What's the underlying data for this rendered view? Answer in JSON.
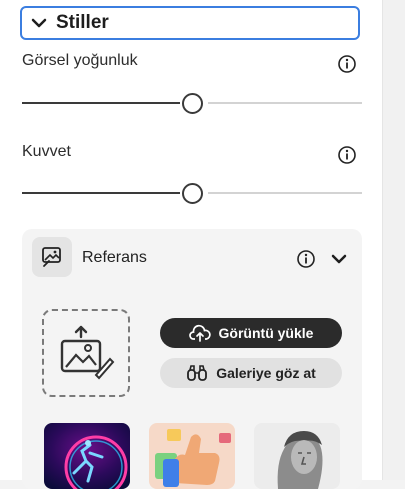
{
  "section": {
    "title": "Stiller"
  },
  "sliders": [
    {
      "label": "Görsel yoğunluk",
      "value": 0.5
    },
    {
      "label": "Kuvvet",
      "value": 0.5
    }
  ],
  "reference": {
    "title": "Referans",
    "upload_button": "Görüntü yükle",
    "gallery_button": "Galeriye göz at",
    "thumbnails": [
      {
        "name": "neon-dancer-thumbnail"
      },
      {
        "name": "thumbs-up-thumbnail"
      },
      {
        "name": "statue-bust-thumbnail"
      }
    ]
  },
  "colors": {
    "focus_border": "#3b7ee0",
    "primary_button": "#2b2b2b",
    "secondary_button": "#e1e1e1"
  },
  "icons": [
    "chevron-down-icon",
    "info-icon",
    "image-reference-icon",
    "image-upload-icon",
    "cloud-upload-icon",
    "binoculars-icon"
  ]
}
